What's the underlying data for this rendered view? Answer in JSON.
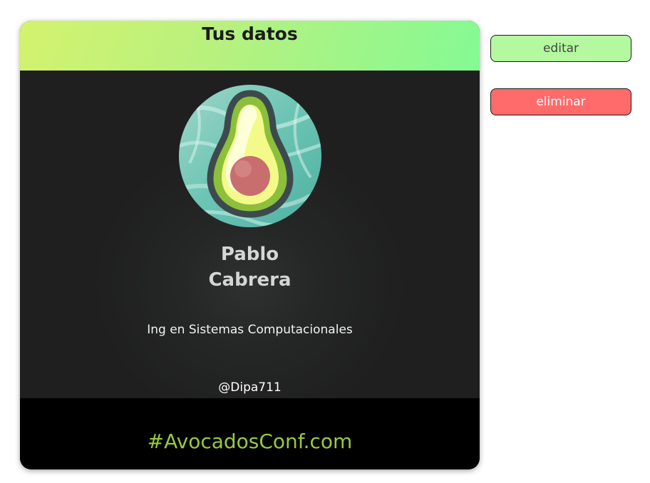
{
  "badge": {
    "title": "Tus datos",
    "first_name": "Pablo",
    "last_name": "Cabrera",
    "job_title": "Ing en Sistemas Computacionales",
    "twitter": "@Dipa711",
    "footer": "#AvocadosConf.com",
    "avatar_icon": "avocado-icon"
  },
  "actions": {
    "edit_label": "editar",
    "delete_label": "eliminar"
  },
  "colors": {
    "header_gradient_start": "#d4f26e",
    "header_gradient_end": "#84fa94",
    "footer_text": "#98ca3f",
    "edit_button": "#b4f9a0",
    "delete_button": "#ff6b6b"
  }
}
